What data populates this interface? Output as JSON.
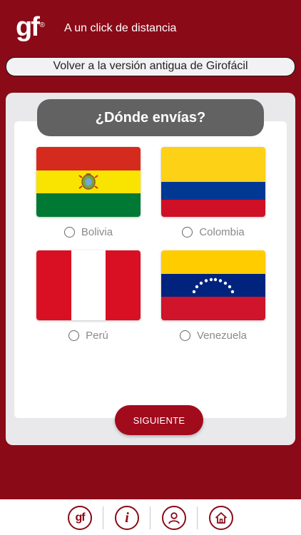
{
  "header": {
    "logo_text": "gf",
    "logo_reg": "®",
    "tagline": "A un click de distancia"
  },
  "old_version_button": "Volver a la versión antigua de Girofácil",
  "main": {
    "title": "¿Dónde envías?",
    "countries": [
      {
        "label": "Bolivia",
        "selected": false
      },
      {
        "label": "Colombia",
        "selected": false
      },
      {
        "label": "Perú",
        "selected": false
      },
      {
        "label": "Venezuela",
        "selected": false
      }
    ],
    "next_button": "SIGUIENTE"
  },
  "bottom_nav": {
    "items": [
      {
        "icon": "gf-logo-icon",
        "text": "gf"
      },
      {
        "icon": "info-icon",
        "text": "i"
      },
      {
        "icon": "user-icon"
      },
      {
        "icon": "home-icon"
      }
    ]
  },
  "colors": {
    "brand": "#8b0a17",
    "button": "#a10b1c",
    "title_pill": "#626262"
  }
}
